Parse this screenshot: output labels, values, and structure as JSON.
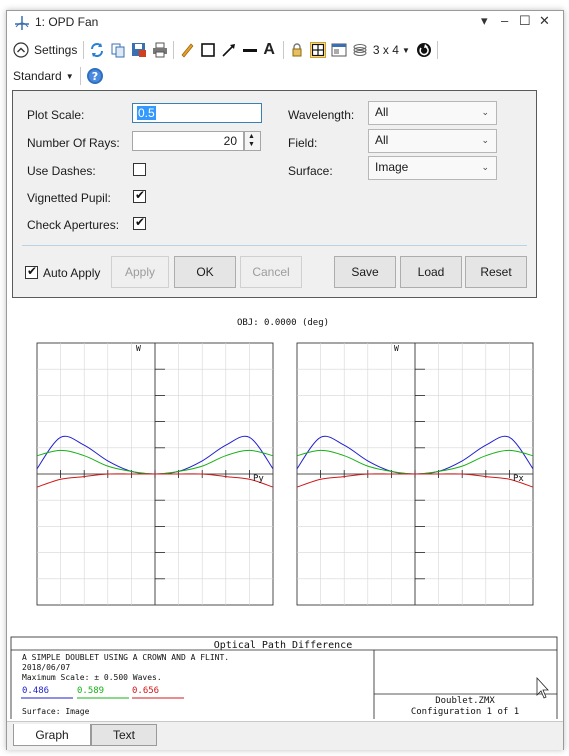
{
  "window": {
    "title": "1: OPD Fan",
    "controls": [
      "▾",
      "–",
      "☐",
      "✕"
    ]
  },
  "toolbar": {
    "settings_label": "Settings",
    "layout_label": "3 x 4",
    "standard_label": "Standard",
    "text_tool_glyph": "A"
  },
  "form": {
    "plot_scale": {
      "label": "Plot Scale:",
      "value": "0.5"
    },
    "num_rays": {
      "label": "Number Of Rays:",
      "value": "20"
    },
    "use_dashes": {
      "label": "Use Dashes:",
      "checked": false
    },
    "vignetted_pupil": {
      "label": "Vignetted Pupil:",
      "checked": true
    },
    "check_apertures": {
      "label": "Check Apertures:",
      "checked": true
    },
    "wavelength": {
      "label": "Wavelength:",
      "value": "All"
    },
    "field": {
      "label": "Field:",
      "value": "All"
    },
    "surface": {
      "label": "Surface:",
      "value": "Image"
    },
    "auto_apply": {
      "label": "Auto Apply",
      "checked": true
    },
    "buttons": {
      "apply": "Apply",
      "ok": "OK",
      "cancel": "Cancel",
      "save": "Save",
      "load": "Load",
      "reset": "Reset"
    }
  },
  "plot": {
    "obj_label": "OBJ: 0.0000 (deg)",
    "left_axis_label": "W",
    "right_axis_label": "W",
    "left_x_label": "Py",
    "right_x_label": "Px"
  },
  "chart_data": {
    "type": "line",
    "title": "Optical Path Difference",
    "plots": [
      {
        "xlabel": "Py",
        "ylabel": "W",
        "series": [
          {
            "name": "0.486",
            "color": "#1f1fd0",
            "x": [
              -1,
              -0.8,
              -0.6,
              -0.4,
              -0.2,
              0,
              0.2,
              0.4,
              0.6,
              0.8,
              1
            ],
            "y": [
              0.02,
              0.14,
              0.11,
              0.05,
              0.01,
              0,
              0.01,
              0.05,
              0.11,
              0.14,
              0.02
            ]
          },
          {
            "name": "0.589",
            "color": "#16b016",
            "x": [
              -1,
              -0.8,
              -0.6,
              -0.4,
              -0.2,
              0,
              0.2,
              0.4,
              0.6,
              0.8,
              1
            ],
            "y": [
              0.07,
              0.09,
              0.07,
              0.03,
              0.01,
              0,
              0.01,
              0.03,
              0.07,
              0.09,
              0.07
            ]
          },
          {
            "name": "0.656",
            "color": "#d01818",
            "x": [
              -1,
              -0.8,
              -0.6,
              -0.4,
              -0.2,
              0,
              0.2,
              0.4,
              0.6,
              0.8,
              1
            ],
            "y": [
              -0.05,
              -0.02,
              -0.01,
              0,
              0,
              0,
              0,
              0,
              -0.01,
              -0.02,
              -0.05
            ]
          }
        ]
      },
      {
        "xlabel": "Px",
        "ylabel": "W",
        "series": [
          {
            "name": "0.486",
            "color": "#1f1fd0",
            "x": [
              -1,
              -0.8,
              -0.6,
              -0.4,
              -0.2,
              0,
              0.2,
              0.4,
              0.6,
              0.8,
              1
            ],
            "y": [
              0.02,
              0.14,
              0.11,
              0.05,
              0.01,
              0,
              0.01,
              0.05,
              0.11,
              0.14,
              0.02
            ]
          },
          {
            "name": "0.589",
            "color": "#16b016",
            "x": [
              -1,
              -0.8,
              -0.6,
              -0.4,
              -0.2,
              0,
              0.2,
              0.4,
              0.6,
              0.8,
              1
            ],
            "y": [
              0.07,
              0.09,
              0.07,
              0.03,
              0.01,
              0,
              0.01,
              0.03,
              0.07,
              0.09,
              0.07
            ]
          },
          {
            "name": "0.656",
            "color": "#d01818",
            "x": [
              -1,
              -0.8,
              -0.6,
              -0.4,
              -0.2,
              0,
              0.2,
              0.4,
              0.6,
              0.8,
              1
            ],
            "y": [
              -0.05,
              -0.02,
              -0.01,
              0,
              0,
              0,
              0,
              0,
              -0.01,
              -0.02,
              -0.05
            ]
          }
        ]
      }
    ],
    "ylim": [
      -0.5,
      0.5
    ],
    "xlim": [
      -1,
      1
    ],
    "grid": true
  },
  "infobox": {
    "title": "Optical Path Difference",
    "lines": [
      "A SIMPLE DOUBLET USING A CROWN AND A FLINT.",
      "2018/06/07",
      "Maximum Scale: ± 0.500 Waves."
    ],
    "wavelengths": [
      {
        "value": "0.486",
        "color": "#1f1fd0"
      },
      {
        "value": "0.589",
        "color": "#16b016"
      },
      {
        "value": "0.656",
        "color": "#d01818"
      }
    ],
    "surface": "Surface: Image",
    "file": "Doublet.ZMX",
    "config": "Configuration 1 of 1"
  },
  "tabs": [
    {
      "label": "Graph",
      "active": true
    },
    {
      "label": "Text",
      "active": false
    }
  ]
}
